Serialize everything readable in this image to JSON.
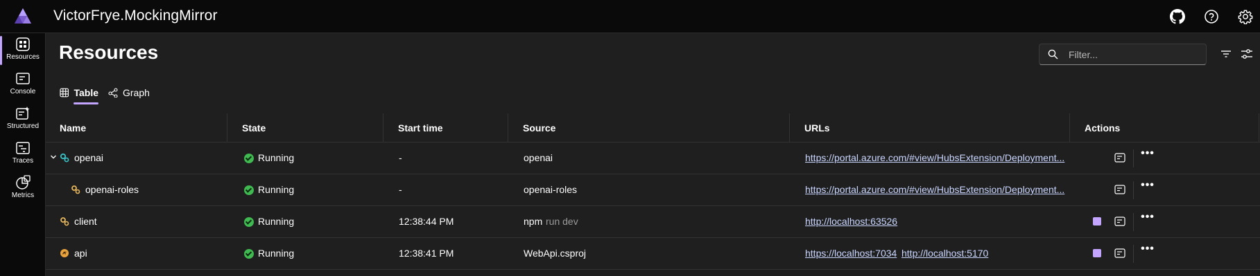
{
  "app": {
    "title": "VictorFrye.MockingMirror"
  },
  "nav": {
    "items": [
      {
        "label": "Resources",
        "icon": "resources-icon",
        "active": true
      },
      {
        "label": "Console",
        "icon": "console-icon",
        "active": false
      },
      {
        "label": "Structured",
        "icon": "structured-icon",
        "active": false
      },
      {
        "label": "Traces",
        "icon": "traces-icon",
        "active": false
      },
      {
        "label": "Metrics",
        "icon": "metrics-icon",
        "active": false
      }
    ]
  },
  "page": {
    "title": "Resources"
  },
  "filter": {
    "placeholder": "Filter..."
  },
  "tabs": [
    {
      "label": "Table",
      "icon": "table-icon",
      "active": true
    },
    {
      "label": "Graph",
      "icon": "graph-icon",
      "active": false
    }
  ],
  "columns": [
    "Name",
    "State",
    "Start time",
    "Source",
    "URLs",
    "Actions"
  ],
  "rows": [
    {
      "name": "openai",
      "state": "Running",
      "start": "-",
      "source": "openai",
      "source_extra": "",
      "urls": [
        "https://portal.azure.com/#view/HubsExtension/Deployment..."
      ],
      "stop": false
    },
    {
      "name": "openai-roles",
      "state": "Running",
      "start": "-",
      "source": "openai-roles",
      "source_extra": "",
      "urls": [
        "https://portal.azure.com/#view/HubsExtension/Deployment..."
      ],
      "stop": false
    },
    {
      "name": "client",
      "state": "Running",
      "start": "12:38:44 PM",
      "source": "npm",
      "source_extra": "run dev",
      "urls": [
        "http://localhost:63526"
      ],
      "stop": true
    },
    {
      "name": "api",
      "state": "Running",
      "start": "12:38:41 PM",
      "source": "WebApi.csproj",
      "source_extra": "",
      "urls": [
        "https://localhost:7034",
        "http://localhost:5170"
      ],
      "stop": true
    }
  ],
  "colors": {
    "accent": "#c3a5ff",
    "running": "#3fb950",
    "background": "#1f1f1f",
    "topbar": "#0a0a0a"
  }
}
